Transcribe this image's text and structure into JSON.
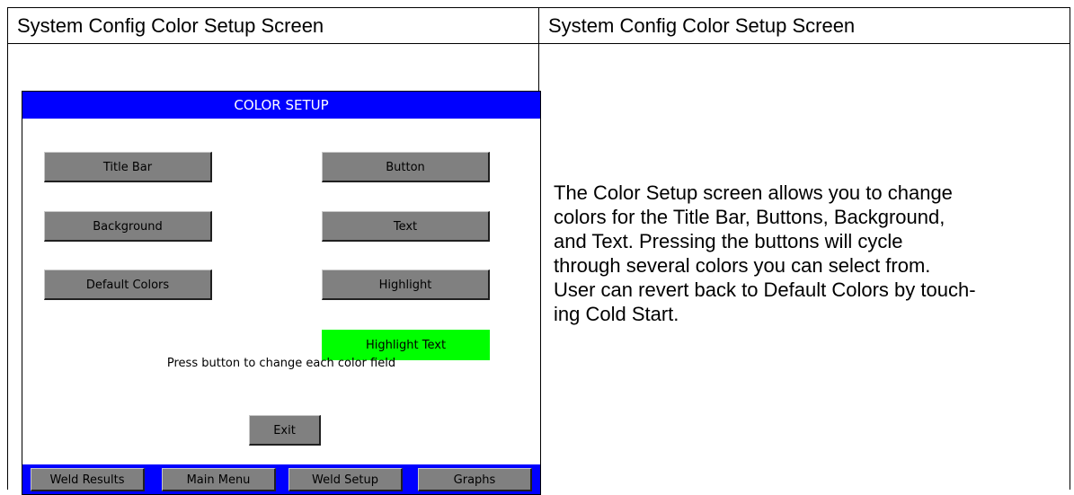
{
  "table": {
    "header_left": "System Config Color Setup Screen",
    "header_right": "System Config Color Setup Screen"
  },
  "device": {
    "title": "COLOR SETUP",
    "buttons": {
      "title_bar": "Title Bar",
      "button": "Button",
      "background": "Background",
      "text": "Text",
      "default_colors": "Default Colors",
      "highlight": "Highlight",
      "highlight_text": "Highlight Text"
    },
    "hint": "Press button to change each color field",
    "exit": "Exit",
    "nav": [
      "Weld Results",
      "Main Menu",
      "Weld Setup",
      "Graphs"
    ],
    "colors": {
      "title_bar": "#0000ff",
      "button": "#808080",
      "highlight_text_bg": "#00ff00"
    }
  },
  "description": {
    "lines": [
      "The Color Setup screen allows you to change",
      "colors for the Title Bar, Buttons, Background,",
      "and Text. Pressing the buttons will cycle",
      "through several colors you can select from.",
      "User can revert back to Default Colors by touch-",
      "ing Cold Start."
    ]
  }
}
